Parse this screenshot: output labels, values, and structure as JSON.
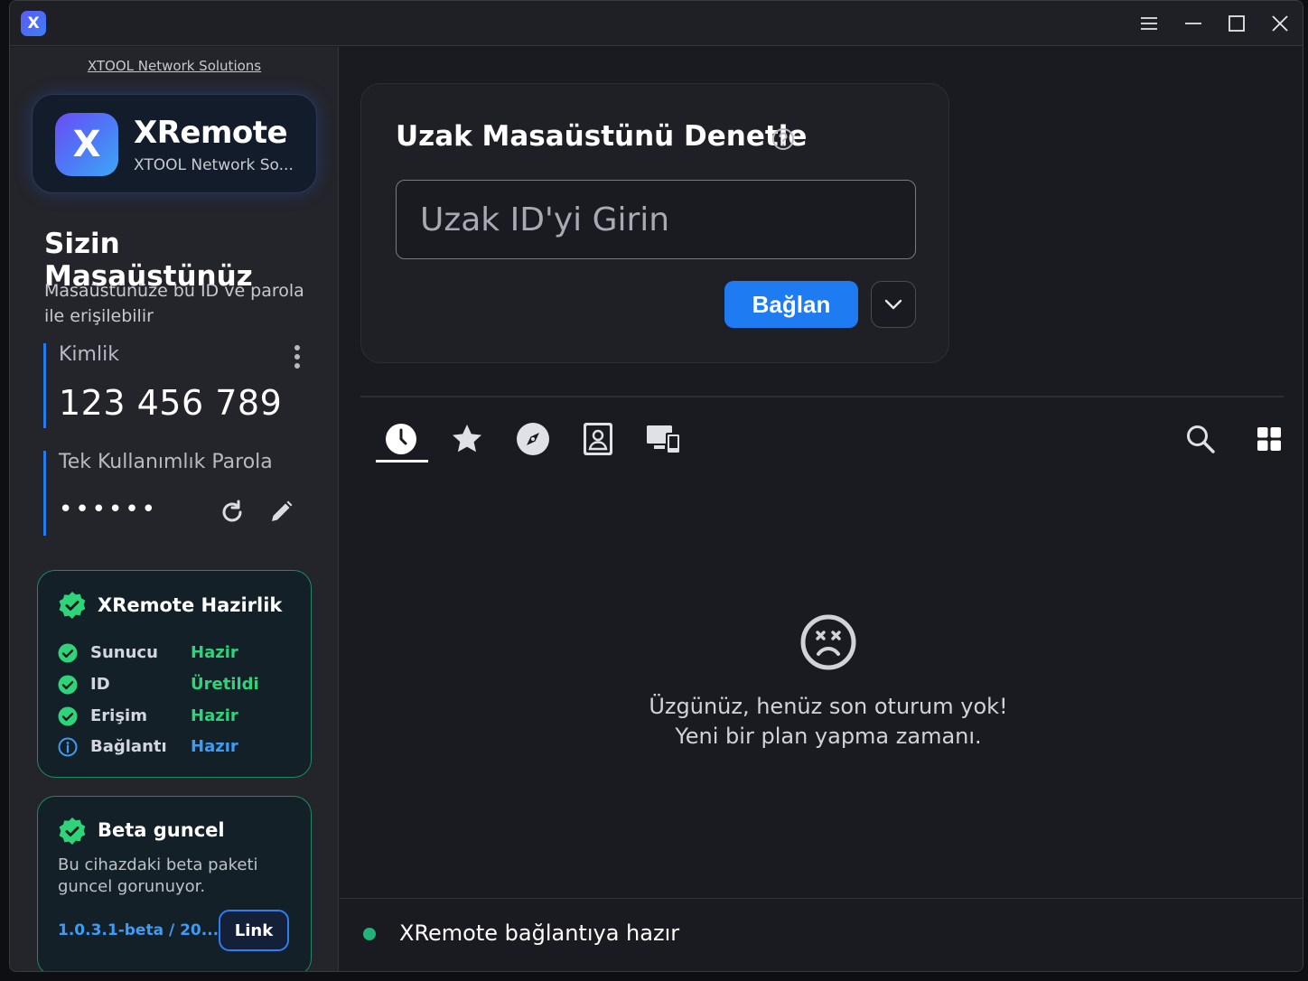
{
  "titlebar": {
    "app_icon_letter": "X",
    "buttons": [
      "menu-icon",
      "minimize-icon",
      "maximize-icon",
      "close-icon"
    ]
  },
  "sidebar": {
    "company_link": "XTOOL Network Solutions",
    "brand": {
      "logo_letter": "X",
      "name": "XRemote",
      "subtitle": "XTOOL Network So..."
    },
    "your_desktop": {
      "title": "Sizin Masaüstünüz",
      "description": "Masaüstünüze bu ID ve parola ile erişilebilir",
      "id_label": "Kimlik",
      "id_value": "123 456 789",
      "password_label": "Tek Kullanımlık Parola",
      "password_value": "••••••"
    },
    "readiness": {
      "title": "XRemote Hazirlik",
      "rows": [
        {
          "name": "Sunucu",
          "value": "Hazir",
          "status": "ok",
          "color": "#2fd47a"
        },
        {
          "name": "ID",
          "value": "Üretildi",
          "status": "ok",
          "color": "#2fd47a"
        },
        {
          "name": "Erişim",
          "value": "Hazir",
          "status": "ok",
          "color": "#2fd47a"
        },
        {
          "name": "Bağlantı",
          "value": "Hazır",
          "status": "info",
          "color": "#3d9cf5"
        }
      ]
    },
    "beta": {
      "title": "Beta guncel",
      "text": "Bu cihazdaki beta paketi guncel gorunuyor.",
      "version": "1.0.3.1-beta / 20...",
      "link_label": "Link"
    }
  },
  "main": {
    "control": {
      "title": "Uzak Masaüstünü Denetle",
      "input_placeholder": "Uzak ID'yi Girin",
      "input_value": "",
      "connect_label": "Bağlan"
    },
    "tabs": [
      {
        "icon": "clock-icon",
        "active": true
      },
      {
        "icon": "star-icon",
        "active": false
      },
      {
        "icon": "compass-icon",
        "active": false
      },
      {
        "icon": "contact-card-icon",
        "active": false
      },
      {
        "icon": "devices-icon",
        "active": false
      }
    ],
    "toolbar_icons": [
      "search-icon",
      "grid-view-icon"
    ],
    "empty_state": {
      "icon": "sad-face-icon",
      "line1": "Üzgünüz, henüz son oturum yok!",
      "line2": "Yeni bir plan yapma zamanı."
    },
    "status": {
      "text": "XRemote bağlantıya hazır",
      "color": "#22b27a"
    }
  },
  "colors": {
    "accent": "#1e7bf2",
    "success": "#2fd47a",
    "info": "#3d9cf5"
  }
}
